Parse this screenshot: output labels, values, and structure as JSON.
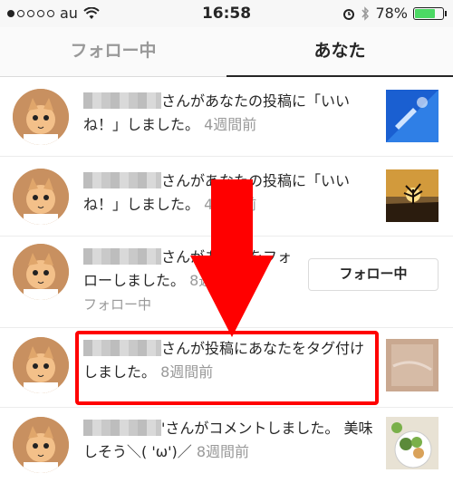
{
  "status": {
    "carrier": "au",
    "time": "16:58",
    "battery": "78%",
    "battery_level": 0.78
  },
  "tabs": [
    {
      "label": "フォロー中"
    },
    {
      "label": "あなた"
    }
  ],
  "notifications": [
    {
      "text": "さんがあなたの投稿に「いいね！」しました。",
      "when": "4週間前"
    },
    {
      "text": "さんがあなたの投稿に「いいね！」しました。",
      "when": "4週間前"
    },
    {
      "text": "さんがあなたをフォローしました。",
      "when": "8週間前",
      "sub": "フォロー中",
      "button": "フォロー中"
    },
    {
      "text": "さんが投稿にあなたをタグ付けしました。",
      "when": "8週間前"
    },
    {
      "text": "'さんがコメントしました。 美味しそう＼( 'ω')／",
      "when": "8週間前"
    }
  ]
}
